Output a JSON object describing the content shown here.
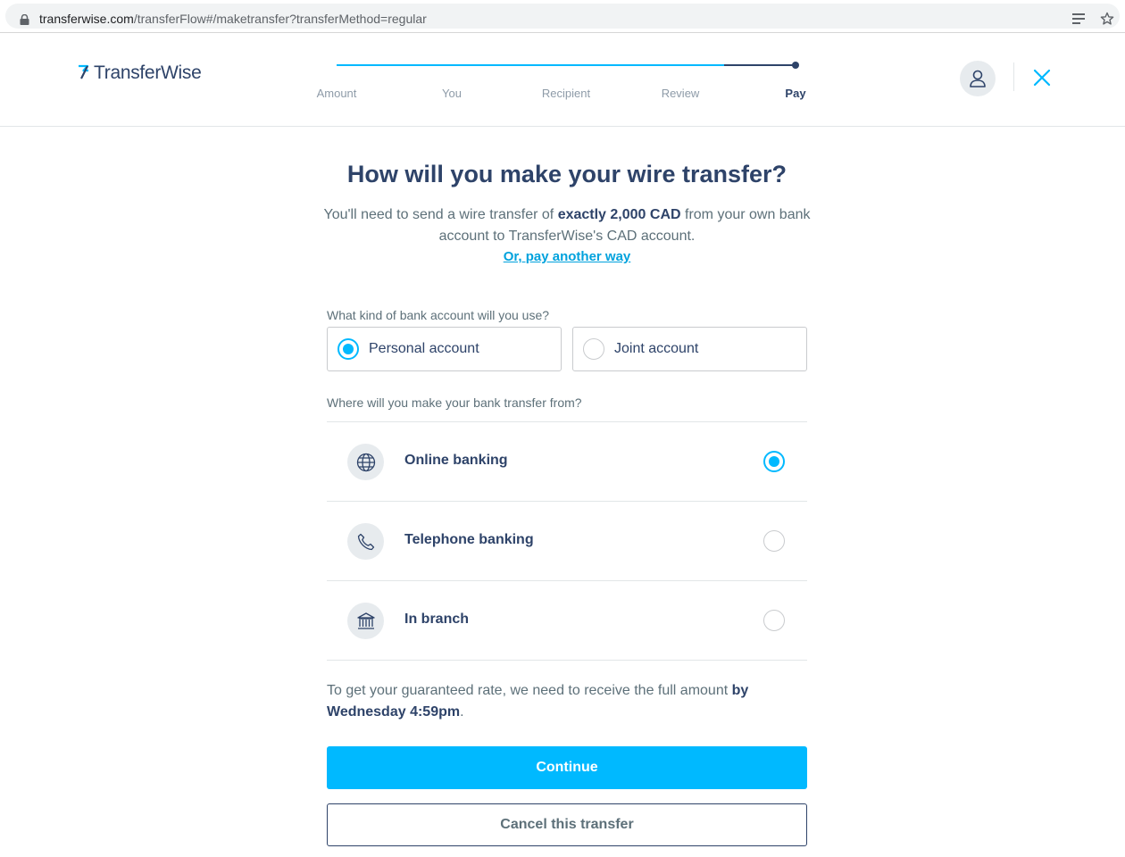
{
  "browser": {
    "url_host": "transferwise.com",
    "url_path": "/transferFlow#/maketransfer?transferMethod=regular",
    "icons": [
      "lock-icon",
      "reader-mode-icon",
      "star-icon"
    ]
  },
  "header": {
    "logo_text": "TransferWise",
    "steps": [
      {
        "label": "Amount"
      },
      {
        "label": "You"
      },
      {
        "label": "Recipient"
      },
      {
        "label": "Review"
      },
      {
        "label": "Pay"
      }
    ],
    "active_step": "Pay",
    "icons": [
      "user-icon",
      "close-icon"
    ]
  },
  "main": {
    "title": "How will you make your wire transfer?",
    "intro": {
      "part1": "You'll need to send a wire transfer of ",
      "amount": "exactly 2,000 CAD",
      "part2": " from your own bank account to TransferWise's CAD account."
    },
    "pay_other_link": "Or, pay another way",
    "account_question": "What kind of bank account will you use?",
    "account_options": [
      {
        "label": "Personal account",
        "selected": true
      },
      {
        "label": "Joint account",
        "selected": false
      }
    ],
    "method_question": "Where will you make your bank transfer from?",
    "methods": [
      {
        "label": "Online banking",
        "icon": "globe-icon",
        "selected": true
      },
      {
        "label": "Telephone banking",
        "icon": "phone-icon",
        "selected": false
      },
      {
        "label": "In branch",
        "icon": "bank-building-icon",
        "selected": false
      }
    ],
    "deadline": {
      "part1": "To get your guaranteed rate, we need to receive the full amount ",
      "deadline_bold": "by Wednesday 4:59pm",
      "part2": "."
    },
    "continue_label": "Continue",
    "cancel_label": "Cancel this transfer"
  },
  "colors": {
    "accent": "#00b9ff",
    "navy": "#2e4369",
    "link": "#00a2dd",
    "muted": "#5d7079"
  }
}
